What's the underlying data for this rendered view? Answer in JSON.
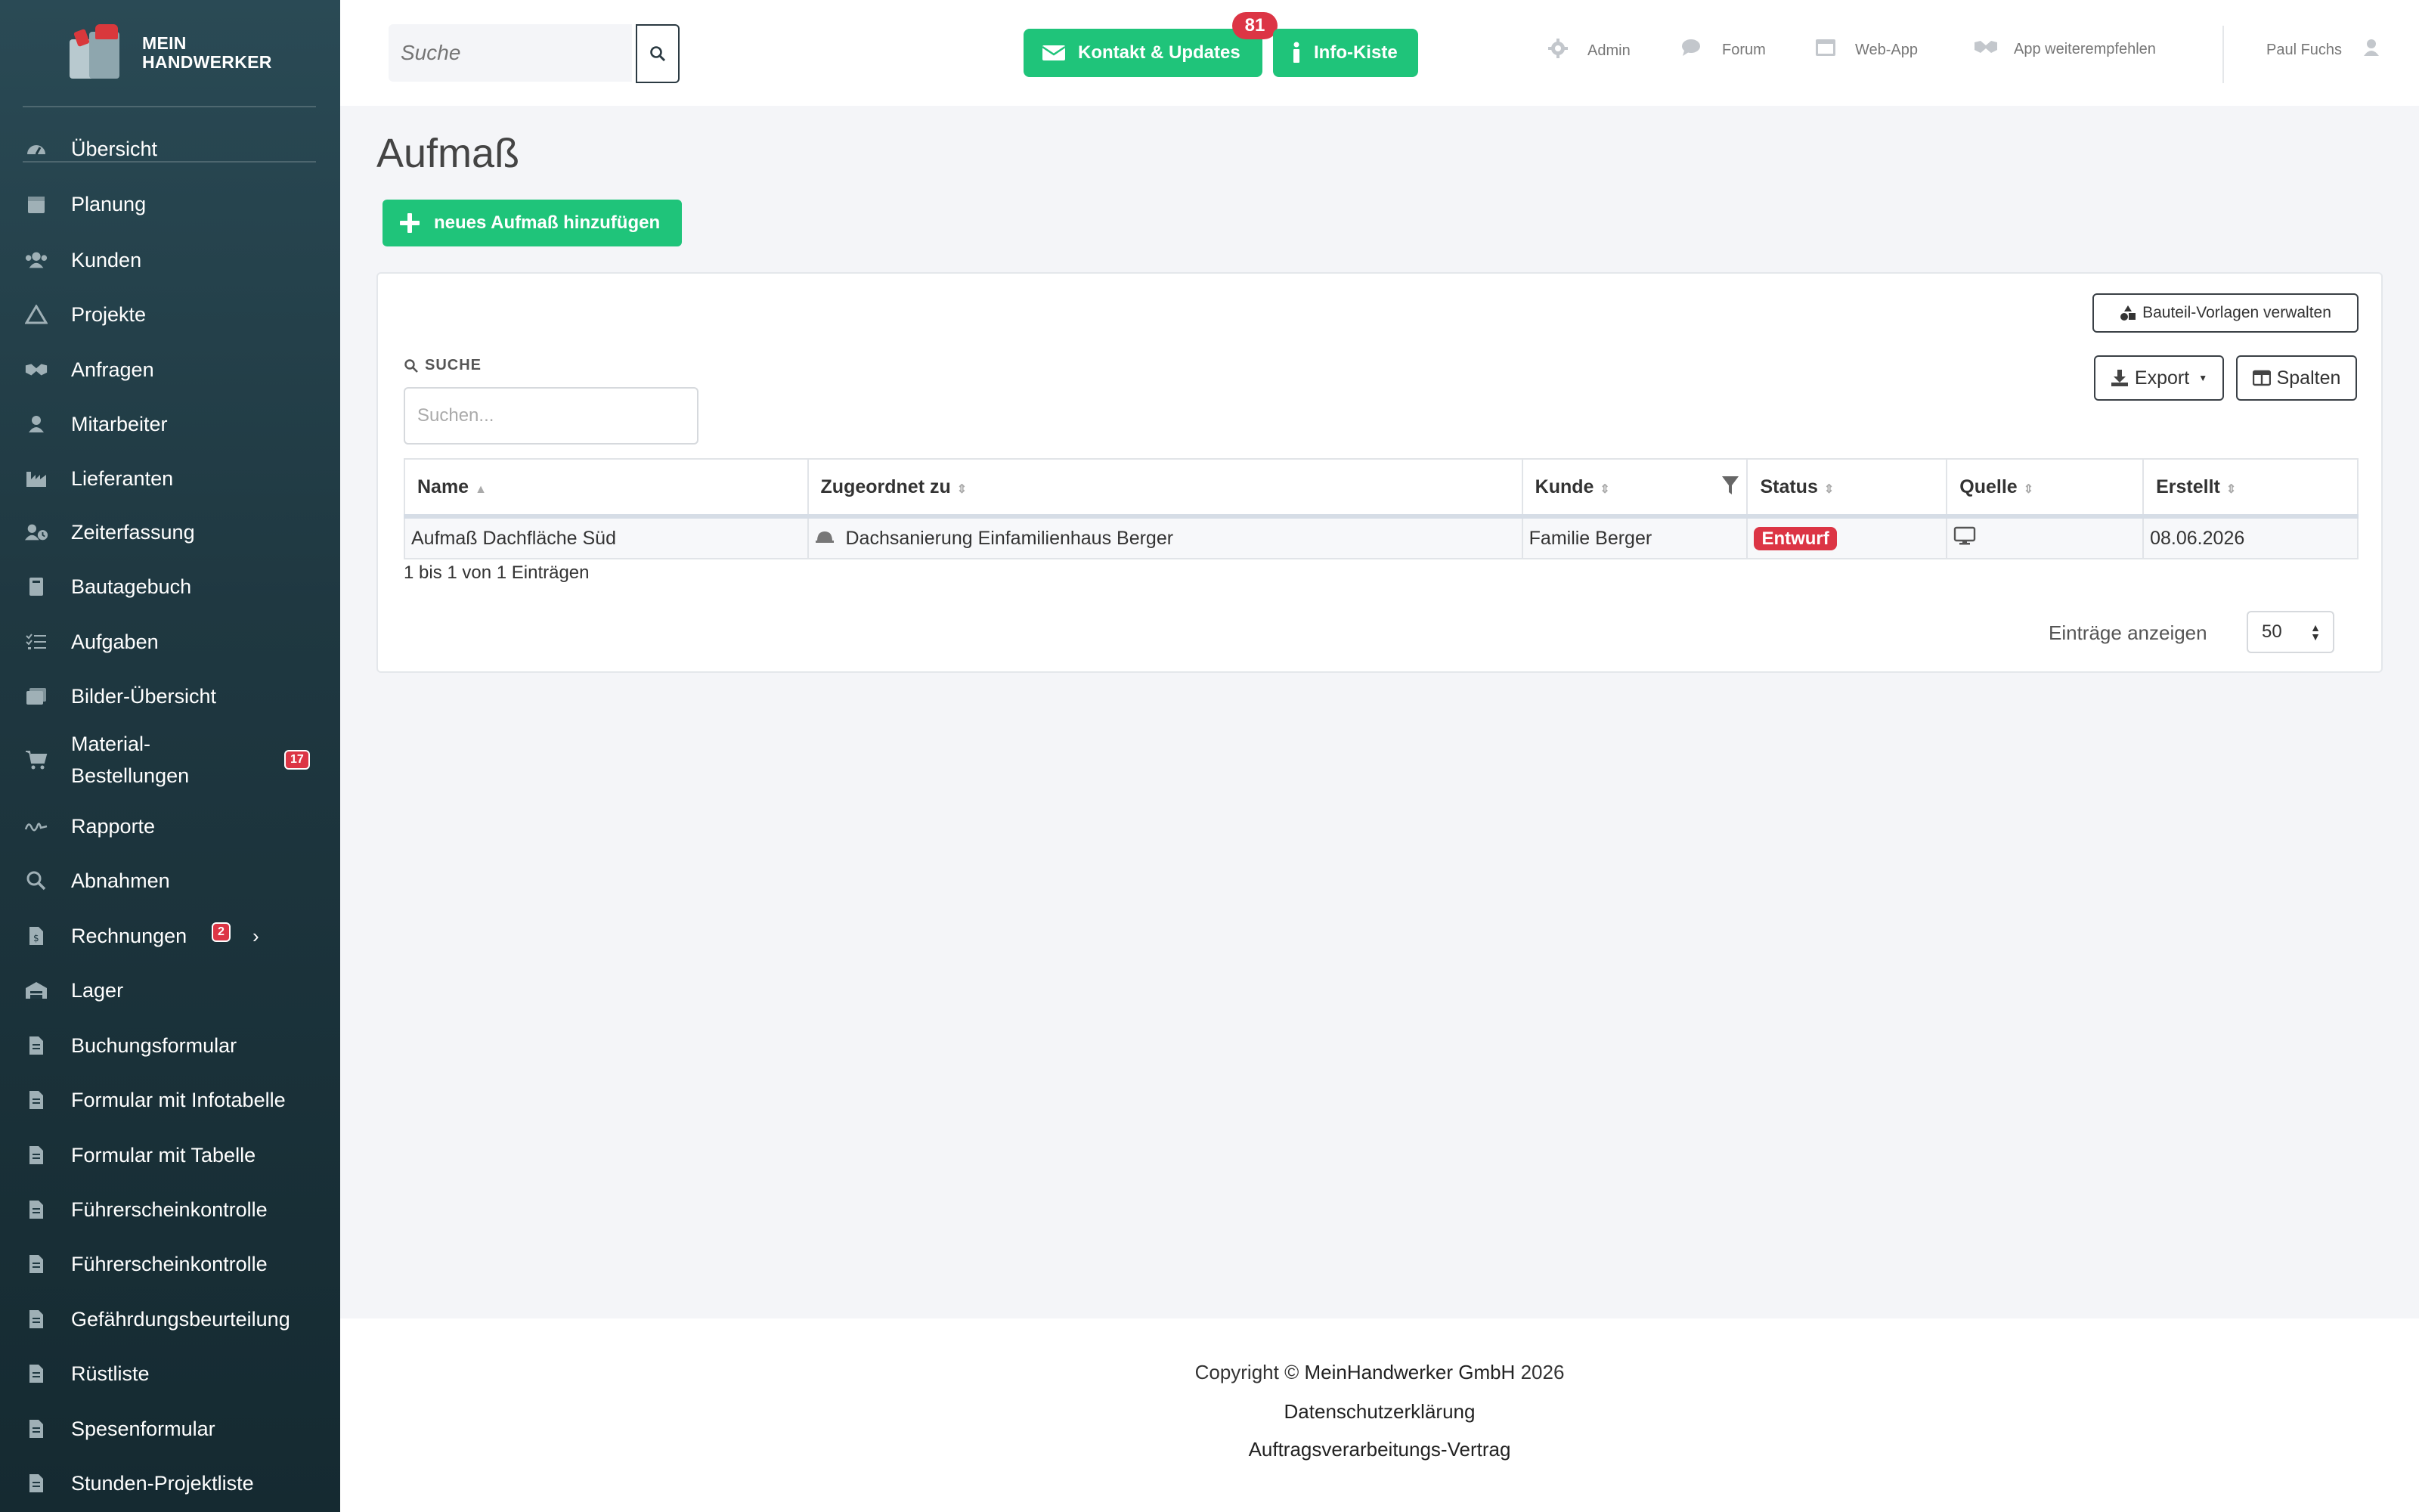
{
  "brand": {
    "line1": "MEIN",
    "line2": "HANDWERKER"
  },
  "sidebar": {
    "items": [
      {
        "label": "Übersicht",
        "icon": "dashboard-icon"
      },
      {
        "label": "Planung",
        "icon": "calendar-icon"
      },
      {
        "label": "Kunden",
        "icon": "users-icon"
      },
      {
        "label": "Projekte",
        "icon": "project-icon"
      },
      {
        "label": "Anfragen",
        "icon": "handshake-icon"
      },
      {
        "label": "Mitarbeiter",
        "icon": "user-icon"
      },
      {
        "label": "Lieferanten",
        "icon": "industry-icon"
      },
      {
        "label": "Zeiterfassung",
        "icon": "user-clock-icon"
      },
      {
        "label": "Bautagebuch",
        "icon": "book-icon"
      },
      {
        "label": "Aufgaben",
        "icon": "tasks-icon"
      },
      {
        "label": "Bilder-Übersicht",
        "icon": "images-icon"
      },
      {
        "label": "Material-Bestellungen",
        "line1": "Material-",
        "line2": "Bestellungen",
        "icon": "cart-icon",
        "badge": "17"
      },
      {
        "label": "Rapporte",
        "icon": "signature-icon"
      },
      {
        "label": "Abnahmen",
        "icon": "search-icon"
      },
      {
        "label": "Rechnungen",
        "icon": "invoice-icon",
        "badge": "2"
      },
      {
        "label": "Lager",
        "icon": "warehouse-icon"
      },
      {
        "label": "Buchungsformular",
        "icon": "document-icon"
      },
      {
        "label": "Formular mit Infotabelle",
        "icon": "document-icon"
      },
      {
        "label": "Formular mit Tabelle",
        "icon": "document-icon"
      },
      {
        "label": "Führerscheinkontrolle",
        "icon": "document-icon"
      },
      {
        "label": "Führerscheinkontrolle",
        "icon": "document-icon"
      },
      {
        "label": "Gefährdungsbeurteilung",
        "icon": "document-icon"
      },
      {
        "label": "Rüstliste",
        "icon": "document-icon"
      },
      {
        "label": "Spesenformular",
        "icon": "document-icon"
      },
      {
        "label": "Stunden-Projektliste",
        "icon": "document-icon"
      }
    ]
  },
  "topbar": {
    "search_placeholder": "Suche",
    "contact_label": "Kontakt & Updates",
    "contact_badge": "81",
    "info_label": "Info-Kiste",
    "links": {
      "admin": "Admin",
      "forum": "Forum",
      "webapp": "Web-App",
      "recommend": "App weiterempfehlen"
    },
    "user_name": "Paul Fuchs"
  },
  "main": {
    "title": "Aufmaß",
    "add_button": "neues Aufmaß hinzufügen",
    "templates_button": "Bauteil-Vorlagen verwalten",
    "export_button": "Export",
    "columns_button": "Spalten",
    "search_label": "SUCHE",
    "search_placeholder": "Suchen...",
    "table": {
      "headers": [
        "Name",
        "Zugeordnet zu",
        "Kunde",
        "Status",
        "Quelle",
        "Erstellt"
      ],
      "rows": [
        {
          "name": "Aufmaß Dachfläche Süd",
          "assigned": "Dachsanierung Einfamilienhaus Berger",
          "customer": "Familie Berger",
          "status": "Entwurf",
          "source_icon": "desktop-icon",
          "created": "08.06.2026"
        }
      ]
    },
    "entries_info": "1 bis 1 von 1 Einträgen",
    "page_length_label": "Einträge anzeigen",
    "page_length_value": "50"
  },
  "footer": {
    "copyright_prefix": "Copyright ©",
    "company": "MeinHandwerker GmbH",
    "year": "2026",
    "privacy": "Datenschutzerklärung",
    "avv": "Auftragsverarbeitungs-Vertrag"
  },
  "colors": {
    "accent_green": "#1fc47a",
    "danger_red": "#dc3545",
    "sidebar_top": "#2a4a55",
    "sidebar_bottom": "#152a31"
  }
}
